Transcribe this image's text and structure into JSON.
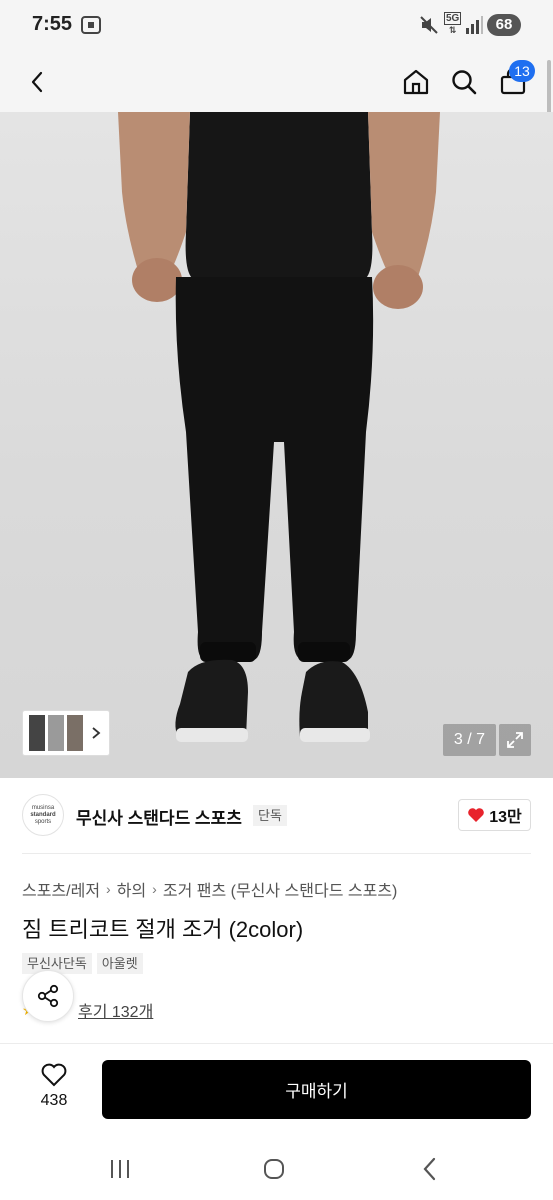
{
  "status_bar": {
    "time": "7:55",
    "network": "5G",
    "battery": "68",
    "icons": [
      "screenshot-icon",
      "mute-icon",
      "network-5g-icon",
      "signal-icon",
      "battery-icon"
    ]
  },
  "header": {
    "icons": [
      "back-icon",
      "home-icon",
      "search-icon",
      "cart-icon"
    ],
    "cart_count": "13"
  },
  "gallery": {
    "counter": "3 / 7",
    "icons": [
      "expand-icon",
      "chevron-right-icon"
    ]
  },
  "brand": {
    "logo_lines": [
      "musinsa",
      "standard",
      "sports"
    ],
    "name": "무신사 스탠다드 스포츠",
    "badge": "단독",
    "like_count": "13만"
  },
  "breadcrumb": [
    "스포츠/레저",
    "하의",
    "조거 팬츠 (무신사 스탠다드 스포츠)"
  ],
  "product": {
    "title": "짐 트리코트 절개 조거 (2color)",
    "tags": [
      "무신사단독",
      "아울렛"
    ],
    "review_link": "후기 132개"
  },
  "bottom": {
    "wish_count": "438",
    "buy_label": "구매하기"
  },
  "colors": {
    "accent_badge": "#1f6ff0",
    "heart": "#e8232c",
    "buy_button": "#000000"
  },
  "nav_bar": {
    "icons": [
      "recent-apps-icon",
      "home-nav-icon",
      "back-nav-icon"
    ]
  }
}
